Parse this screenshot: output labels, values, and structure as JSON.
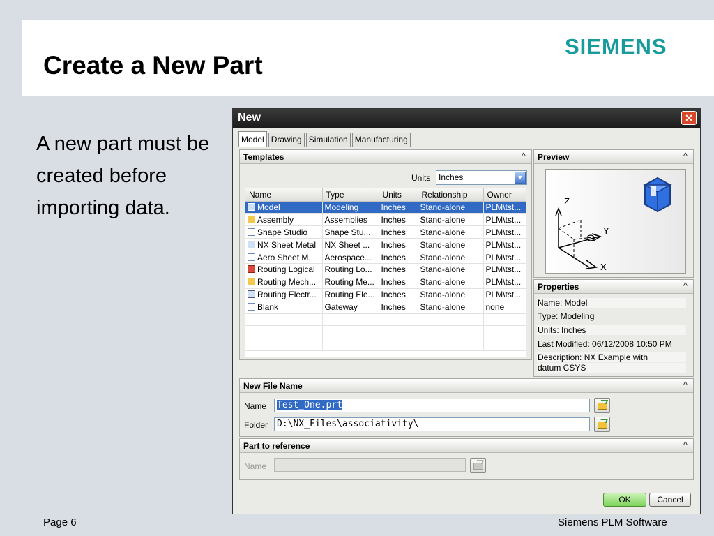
{
  "slide": {
    "title": "Create a New Part",
    "brand": "SIEMENS",
    "body": "A new part must be created before importing data.",
    "footer_page": "Page 6",
    "footer_company": "Siemens PLM Software"
  },
  "dialog": {
    "title": "New",
    "close_symbol": "✕",
    "tabs": [
      "Model",
      "Drawing",
      "Simulation",
      "Manufacturing"
    ],
    "active_tab": "Model",
    "templates": {
      "heading": "Templates",
      "units_label": "Units",
      "units_value": "Inches",
      "columns": [
        "Name",
        "Type",
        "Units",
        "Relationship",
        "Owner"
      ],
      "rows": [
        {
          "name": "Model",
          "type": "Modeling",
          "units": "Inches",
          "relationship": "Stand-alone",
          "owner": "PLM\\tst...",
          "icon": "model-icon"
        },
        {
          "name": "Assembly",
          "type": "Assemblies",
          "units": "Inches",
          "relationship": "Stand-alone",
          "owner": "PLM\\tst...",
          "icon": "assembly-icon"
        },
        {
          "name": "Shape Studio",
          "type": "Shape Stu...",
          "units": "Inches",
          "relationship": "Stand-alone",
          "owner": "PLM\\tst...",
          "icon": "shape-studio-icon"
        },
        {
          "name": "NX Sheet Metal",
          "type": "NX Sheet ...",
          "units": "Inches",
          "relationship": "Stand-alone",
          "owner": "PLM\\tst...",
          "icon": "sheet-metal-icon"
        },
        {
          "name": "Aero Sheet M...",
          "type": "Aerospace...",
          "units": "Inches",
          "relationship": "Stand-alone",
          "owner": "PLM\\tst...",
          "icon": "aero-sheet-metal-icon"
        },
        {
          "name": "Routing Logical",
          "type": "Routing Lo...",
          "units": "Inches",
          "relationship": "Stand-alone",
          "owner": "PLM\\tst...",
          "icon": "routing-logical-icon"
        },
        {
          "name": "Routing Mech...",
          "type": "Routing Me...",
          "units": "Inches",
          "relationship": "Stand-alone",
          "owner": "PLM\\tst...",
          "icon": "routing-mechanical-icon"
        },
        {
          "name": "Routing Electr...",
          "type": "Routing Ele...",
          "units": "Inches",
          "relationship": "Stand-alone",
          "owner": "PLM\\tst...",
          "icon": "routing-electrical-icon"
        },
        {
          "name": "Blank",
          "type": "Gateway",
          "units": "Inches",
          "relationship": "Stand-alone",
          "owner": "none",
          "icon": "blank-icon"
        }
      ],
      "selected_row": 0
    },
    "preview": {
      "heading": "Preview",
      "axis_labels": [
        "Z",
        "Y",
        "X"
      ]
    },
    "properties": {
      "heading": "Properties",
      "lines": [
        "Name: Model",
        "Type: Modeling",
        "Units: Inches",
        "Last Modified: 06/12/2008 10:50 PM",
        "Description: NX Example with",
        "datum CSYS"
      ]
    },
    "new_file_name": {
      "heading": "New File Name",
      "name_label": "Name",
      "name_value": "Test_One.prt",
      "folder_label": "Folder",
      "folder_value": "D:\\NX_Files\\associativity\\"
    },
    "part_to_reference": {
      "heading": "Part to reference",
      "name_label": "Name",
      "name_value": ""
    },
    "buttons": {
      "ok": "OK",
      "cancel": "Cancel"
    },
    "collapse_symbol": "^"
  },
  "colors": {
    "brand": "#179b9c",
    "selection": "#316ac5",
    "ok_button": "#7ed45c",
    "close_button": "#d8492c"
  }
}
